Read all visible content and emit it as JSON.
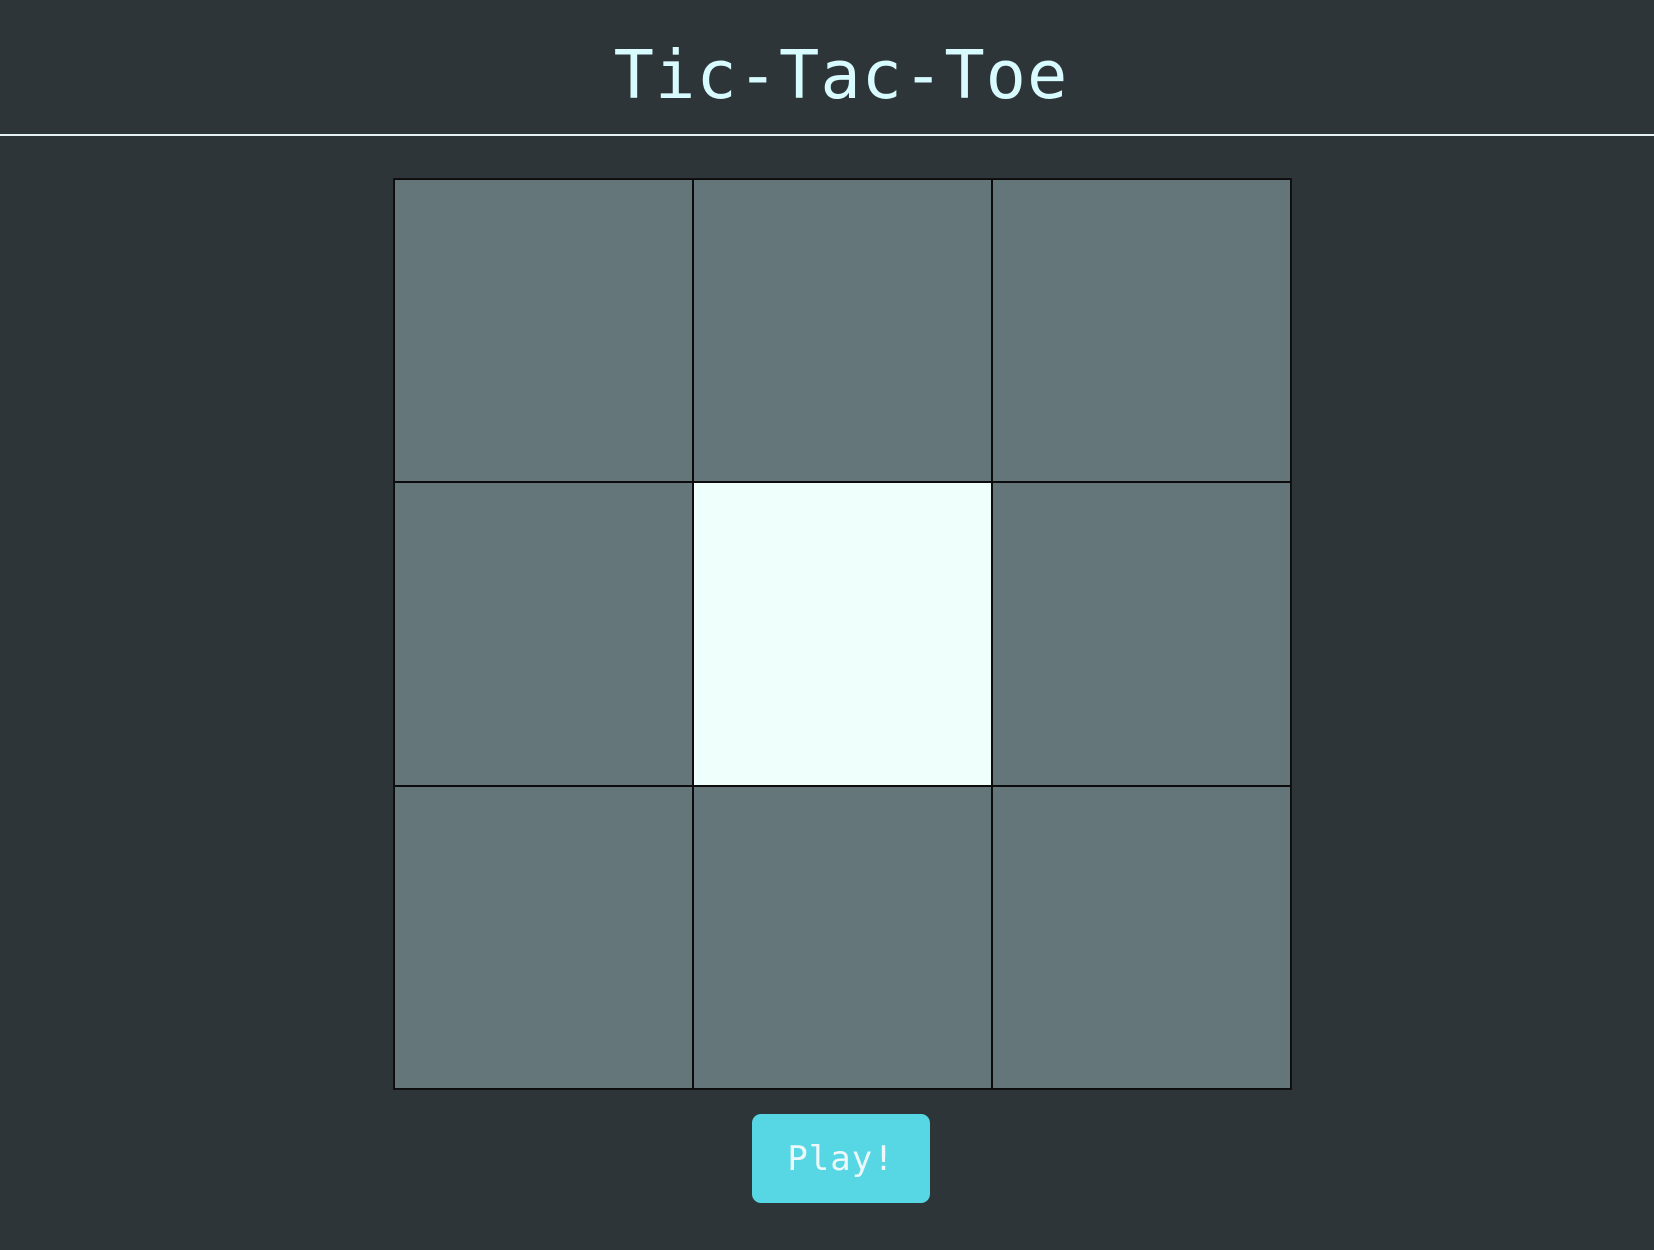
{
  "header": {
    "title": "Tic-Tac-Toe"
  },
  "board": {
    "cells": [
      {
        "value": "",
        "highlighted": false
      },
      {
        "value": "",
        "highlighted": false
      },
      {
        "value": "",
        "highlighted": false
      },
      {
        "value": "",
        "highlighted": false
      },
      {
        "value": "",
        "highlighted": true
      },
      {
        "value": "",
        "highlighted": false
      },
      {
        "value": "",
        "highlighted": false
      },
      {
        "value": "",
        "highlighted": false
      },
      {
        "value": "",
        "highlighted": false
      }
    ]
  },
  "controls": {
    "play_label": "Play!"
  },
  "colors": {
    "background": "#2e3538",
    "title": "#d8fbff",
    "cell": "#647679",
    "cell_highlight": "#effffb",
    "button": "#57d7e3",
    "button_text": "#eef8f8"
  }
}
